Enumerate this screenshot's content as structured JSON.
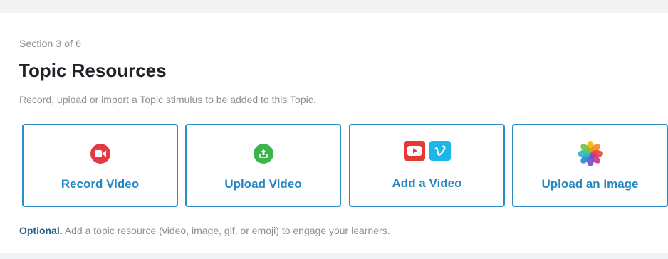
{
  "section": {
    "label": "Section 3 of 6"
  },
  "header": {
    "title": "Topic Resources",
    "description": "Record, upload or import a Topic stimulus to be added to this Topic."
  },
  "cards": [
    {
      "label": "Record Video",
      "icon": "video-camera-icon"
    },
    {
      "label": "Upload Video",
      "icon": "upload-icon"
    },
    {
      "label": "Add a Video",
      "icons": [
        "youtube-icon",
        "vimeo-icon"
      ]
    },
    {
      "label": "Upload an Image",
      "icon": "photos-icon"
    }
  ],
  "footer": {
    "optional_label": "Optional.",
    "text": " Add a topic resource (video, image, gif, or emoji) to engage your learners."
  },
  "colors": {
    "accent": "#2c8ec6",
    "record": "#e03a43",
    "upload": "#3bb54a",
    "youtube": "#e53935",
    "vimeo": "#1ab7ea"
  }
}
